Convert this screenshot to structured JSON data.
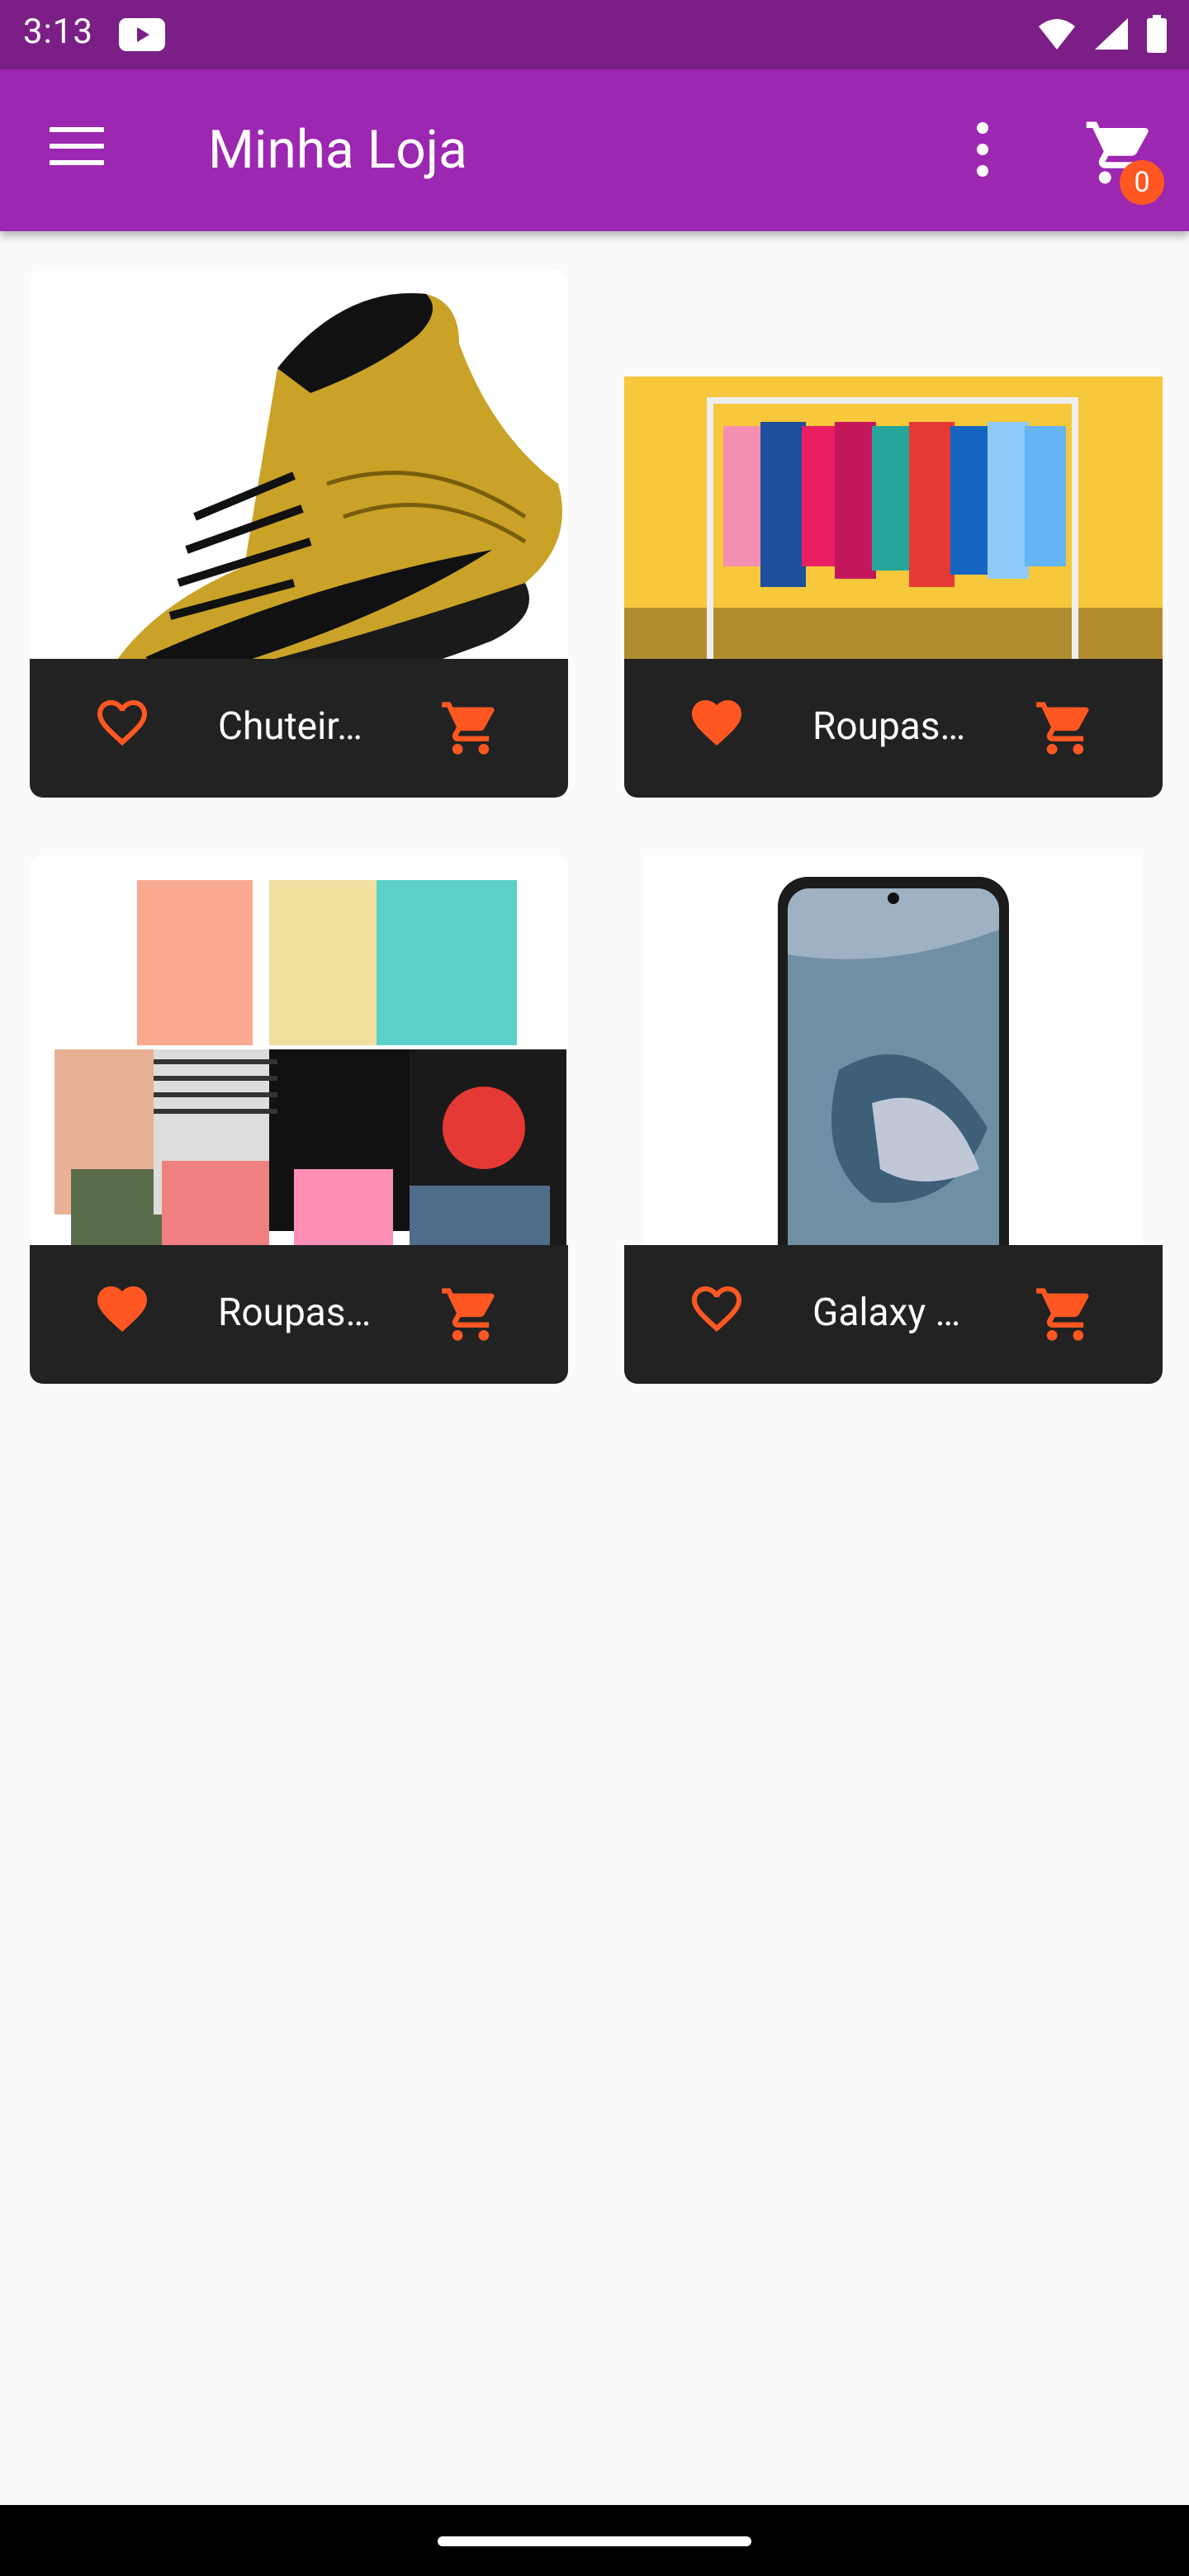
{
  "status_bar": {
    "time": "3:13"
  },
  "app_bar": {
    "title": "Minha Loja",
    "cart_count": "0"
  },
  "colors": {
    "primary": "#9c27b0",
    "primary_dark": "#7b1f87",
    "accent": "#ff5722",
    "card_footer": "#222222"
  },
  "products": [
    {
      "name": "Chuteir…",
      "favorite": false,
      "image": "gold-football-boot"
    },
    {
      "name": "Roupas…",
      "favorite": true,
      "image": "clothes-rack"
    },
    {
      "name": "Roupas…",
      "favorite": true,
      "image": "folded-tshirts"
    },
    {
      "name": "Galaxy …",
      "favorite": false,
      "image": "smartphone"
    }
  ]
}
